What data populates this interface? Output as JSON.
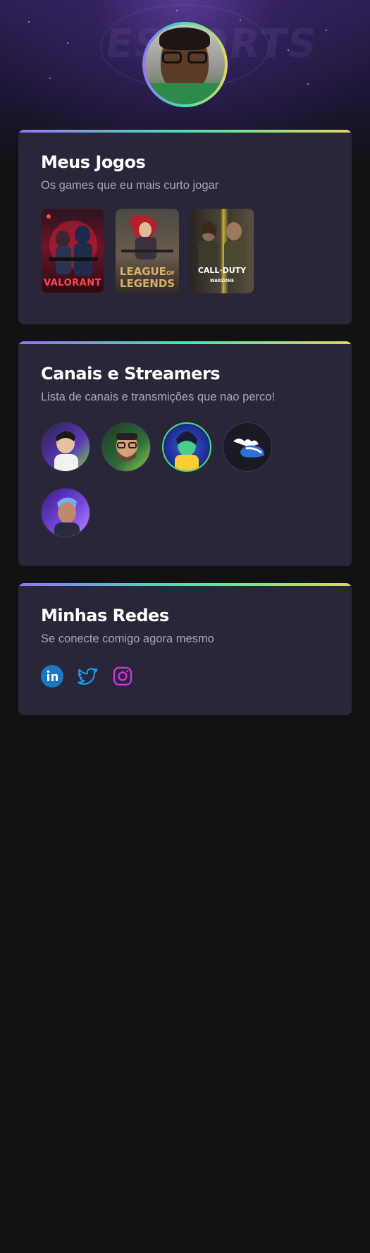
{
  "profile": {
    "avatar_alt": "Foto de perfil"
  },
  "games_card": {
    "title": "Meus Jogos",
    "subtitle": "Os games que eu mais curto jogar",
    "games": [
      {
        "name": "VALORANT",
        "logo": "VALORANT",
        "colors": [
          "#3b0f1a",
          "#d11d3a"
        ]
      },
      {
        "name": "League of Legends",
        "logo_line1": "LEAGUE",
        "logo_of": "OF",
        "logo_line2": "LEGENDS",
        "colors": [
          "#3d3a33",
          "#b98a55"
        ]
      },
      {
        "name": "Call of Duty Warzone",
        "logo_line1": "CALL·DUTY",
        "logo_line2": "WARZONE",
        "colors": [
          "#1d1d1a",
          "#c8b13a"
        ]
      }
    ]
  },
  "streamers_card": {
    "title": "Canais e Streamers",
    "subtitle": "Lista de canais e transmições que nao perco!",
    "streamers": [
      {
        "name": "streamer-1",
        "colors": [
          "#3c2a7a",
          "#7ad83f"
        ]
      },
      {
        "name": "streamer-2",
        "colors": [
          "#1a3a1c",
          "#d8c08a"
        ]
      },
      {
        "name": "streamer-3",
        "colors": [
          "#1e3d8a",
          "#4ee07b"
        ]
      },
      {
        "name": "streamer-4",
        "colors": [
          "#1a1a24",
          "#2c6fd8"
        ]
      },
      {
        "name": "streamer-5",
        "colors": [
          "#5a2fc0",
          "#b58a6a"
        ]
      }
    ]
  },
  "social_card": {
    "title": "Minhas Redes",
    "subtitle": "Se conecte comigo agora mesmo",
    "links": [
      {
        "name": "linkedin-icon",
        "color": "#0a66c2"
      },
      {
        "name": "twitter-icon",
        "color": "#1d9bf0"
      },
      {
        "name": "instagram-icon",
        "color": "#d62fe0"
      }
    ]
  }
}
